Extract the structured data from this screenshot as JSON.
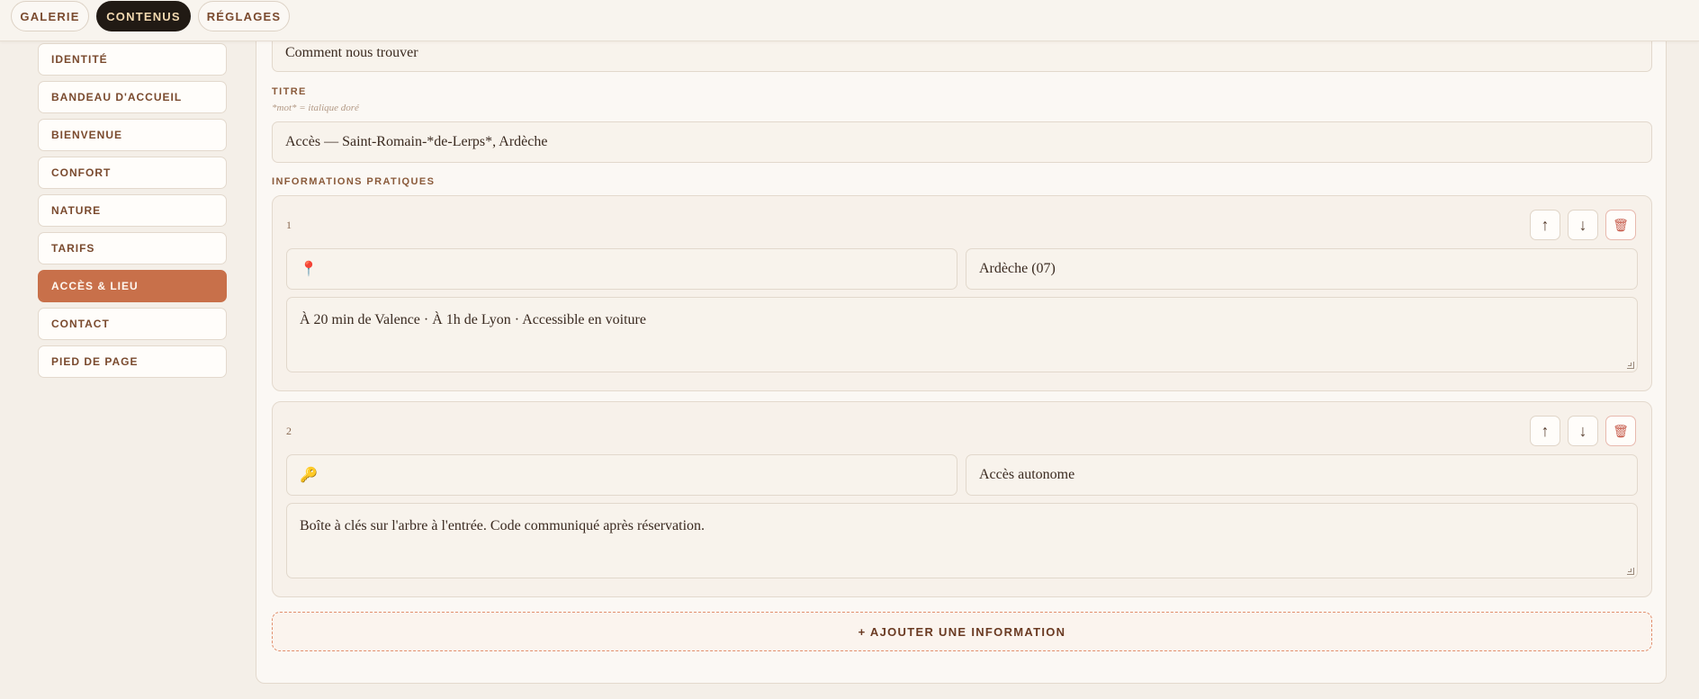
{
  "tabs": [
    {
      "label": "GALERIE",
      "active": false
    },
    {
      "label": "CONTENUS",
      "active": true
    },
    {
      "label": "RÉGLAGES",
      "active": false
    }
  ],
  "sidebar": {
    "items": [
      {
        "label": "IDENTITÉ"
      },
      {
        "label": "BANDEAU D'ACCUEIL"
      },
      {
        "label": "BIENVENUE"
      },
      {
        "label": "CONFORT"
      },
      {
        "label": "NATURE"
      },
      {
        "label": "TARIFS"
      },
      {
        "label": "ACCÈS & LIEU",
        "active": true
      },
      {
        "label": "CONTACT"
      },
      {
        "label": "PIED DE PAGE"
      }
    ]
  },
  "section": {
    "subtitle_value": "Comment nous trouver",
    "title_label": "TITRE",
    "title_hint": "*mot* = italique doré",
    "title_value": "Accès — Saint-Romain-*de-Lerps*, Ardèche",
    "info_label": "INFORMATIONS PRATIQUES"
  },
  "infos": [
    {
      "number": "1",
      "icon": "📍",
      "icon_name": "round-pushpin-icon",
      "title": "Ardèche (07)",
      "text": "À 20 min de Valence · À 1h de Lyon · Accessible en voiture"
    },
    {
      "number": "2",
      "icon": "🔑",
      "icon_name": "key-icon",
      "title": "Accès autonome",
      "text": "Boîte à clés sur l'arbre à l'entrée. Code communiqué après réservation."
    }
  ],
  "buttons": {
    "up": "↑",
    "down": "↓",
    "delete": "🗑",
    "add_info": "+ AJOUTER UNE INFORMATION"
  },
  "colors": {
    "accent": "#c8704a",
    "dark_tab": "#211a14",
    "background": "#f4efe8"
  }
}
